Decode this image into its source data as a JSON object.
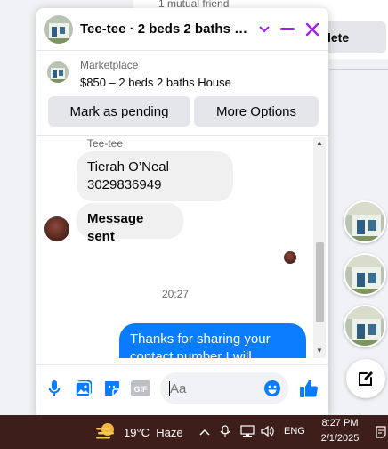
{
  "background": {
    "mutual_friends": "1 mutual friend",
    "delete_label": "lete"
  },
  "chat": {
    "title": "Tee-tee · 2 beds 2 baths H...",
    "header_icons": [
      "chevron-down-icon",
      "minimize-icon",
      "close-icon"
    ],
    "accent_color": "#a020f0",
    "marketplace": {
      "label": "Marketplace",
      "listing": "$850 – 2 beds 2 baths House",
      "mark_pending_label": "Mark as pending",
      "more_options_label": "More Options"
    },
    "messages": {
      "sender_name": "Tee-tee",
      "incoming": [
        {
          "line1": "Tierah O’Neal",
          "line2": "3029836949"
        },
        {
          "text": "Message sent"
        }
      ],
      "timestamp": "20:27",
      "outgoing": {
        "line1": "Thanks for sharing your",
        "line2": "contact number I will"
      }
    },
    "composer": {
      "placeholder": "Aa",
      "icons": [
        "microphone-icon",
        "image-icon",
        "sticker-icon",
        "gif-icon",
        "emoji-icon",
        "like-icon"
      ],
      "gif_label": "GIF"
    }
  },
  "sidebar": {
    "bubble_icons": [
      "contact-avatar",
      "contact-avatar",
      "contact-avatar"
    ],
    "new_message_icon": "compose-icon"
  },
  "taskbar": {
    "temperature": "19°C",
    "condition": "Haze",
    "tray_icons": [
      "chevron-up-icon",
      "meet-now-icon",
      "network-icon",
      "volume-icon"
    ],
    "language": "ENG",
    "time": "8:27 PM",
    "date": "2/1/2025"
  },
  "colors": {
    "messenger_blue": "#0a7cff",
    "bubble_gray": "#f0f0f0",
    "button_gray": "#e4e6eb",
    "taskbar": "#3d1e1a"
  }
}
